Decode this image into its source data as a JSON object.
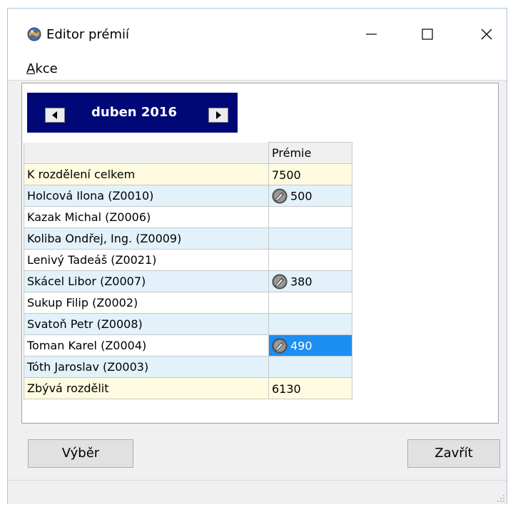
{
  "window": {
    "title": "Editor prémií",
    "icon": "app-globe-icon"
  },
  "menu": {
    "items": [
      {
        "label": "Akce",
        "accel_letter": "A",
        "rest": "kce"
      }
    ]
  },
  "period": {
    "label": "duben 2016",
    "prev_icon": "triangle-left-icon",
    "next_icon": "triangle-right-icon"
  },
  "grid": {
    "columns": [
      "",
      "Prémie"
    ],
    "rows": [
      {
        "name": "K rozdělení celkem",
        "value": "7500",
        "kind": "total",
        "icon": false
      },
      {
        "name": "Holcová Ilona (Z0010)",
        "value": "500",
        "kind": "odd",
        "icon": true
      },
      {
        "name": "Kazak Michal (Z0006)",
        "value": "",
        "kind": "even",
        "icon": false
      },
      {
        "name": "Koliba Ondřej, Ing. (Z0009)",
        "value": "",
        "kind": "odd",
        "icon": false
      },
      {
        "name": "Lenivý Tadeáš (Z0021)",
        "value": "",
        "kind": "even",
        "icon": false
      },
      {
        "name": "Skácel Libor (Z0007)",
        "value": "380",
        "kind": "odd",
        "icon": true
      },
      {
        "name": "Sukup Filip (Z0002)",
        "value": "",
        "kind": "even",
        "icon": false
      },
      {
        "name": "Svatoň Petr (Z0008)",
        "value": "",
        "kind": "odd",
        "icon": false
      },
      {
        "name": "Toman Karel (Z0004)",
        "value": "490",
        "kind": "even",
        "icon": true,
        "selected": true
      },
      {
        "name": "Tóth Jaroslav (Z0003)",
        "value": "",
        "kind": "odd",
        "icon": false
      },
      {
        "name": "Zbývá rozdělit",
        "value": "6130",
        "kind": "total",
        "icon": false
      }
    ]
  },
  "buttons": {
    "select": "Výběr",
    "close": "Zavřít"
  },
  "colors": {
    "nav_bg": "#000878",
    "total_row": "#fffbe0",
    "alt_row": "#e2f1fa",
    "selection": "#1d8ef2"
  }
}
